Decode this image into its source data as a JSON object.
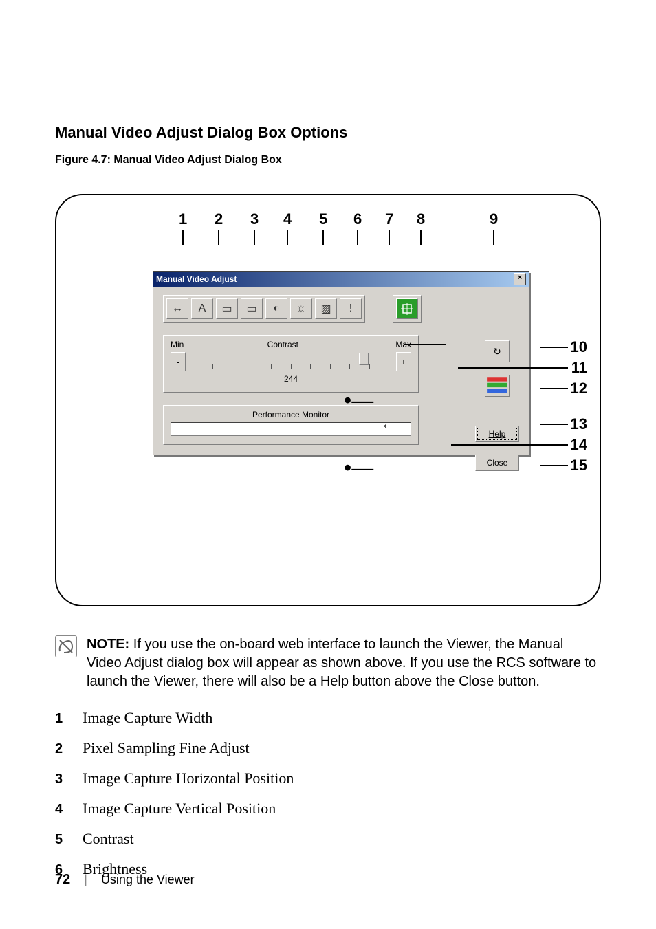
{
  "heading": "Manual Video Adjust Dialog Box Options",
  "figure_caption": "Figure 4.7: Manual Video Adjust Dialog Box",
  "callouts_top": [
    "1",
    "2",
    "3",
    "4",
    "5",
    "6",
    "7",
    "8",
    "9"
  ],
  "callouts_right": [
    "10",
    "11",
    "12",
    "13",
    "14",
    "15"
  ],
  "dialog": {
    "title": "Manual Video Adjust",
    "min_label": "Min",
    "max_label": "Max",
    "slider_label": "Contrast",
    "slider_value": "244",
    "perf_label": "Performance Monitor",
    "help_label": "Help",
    "close_label": "Close",
    "minus": "-",
    "plus": "+"
  },
  "icons": {
    "width": "↔",
    "pixel": "A",
    "hpos": "▭",
    "vpos": "▭",
    "contrast": "◐",
    "bright": "☼",
    "noise": "▨",
    "prio": "!",
    "auto": "⬚",
    "refresh": "↻",
    "bars": "▤"
  },
  "note_label": "NOTE:",
  "note_text": " If you use the on-board web interface to launch the Viewer, the Manual Video Adjust dialog box will appear as shown above. If you use the RCS software to launch the Viewer, there will also be a Help button above the Close button.",
  "list": [
    {
      "n": "1",
      "t": "Image Capture Width"
    },
    {
      "n": "2",
      "t": "Pixel Sampling Fine Adjust"
    },
    {
      "n": "3",
      "t": "Image Capture Horizontal Position"
    },
    {
      "n": "4",
      "t": "Image Capture Vertical Position"
    },
    {
      "n": "5",
      "t": "Contrast"
    },
    {
      "n": "6",
      "t": "Brightness"
    }
  ],
  "footer": {
    "page": "72",
    "section": "Using the Viewer",
    "sep": "|"
  }
}
